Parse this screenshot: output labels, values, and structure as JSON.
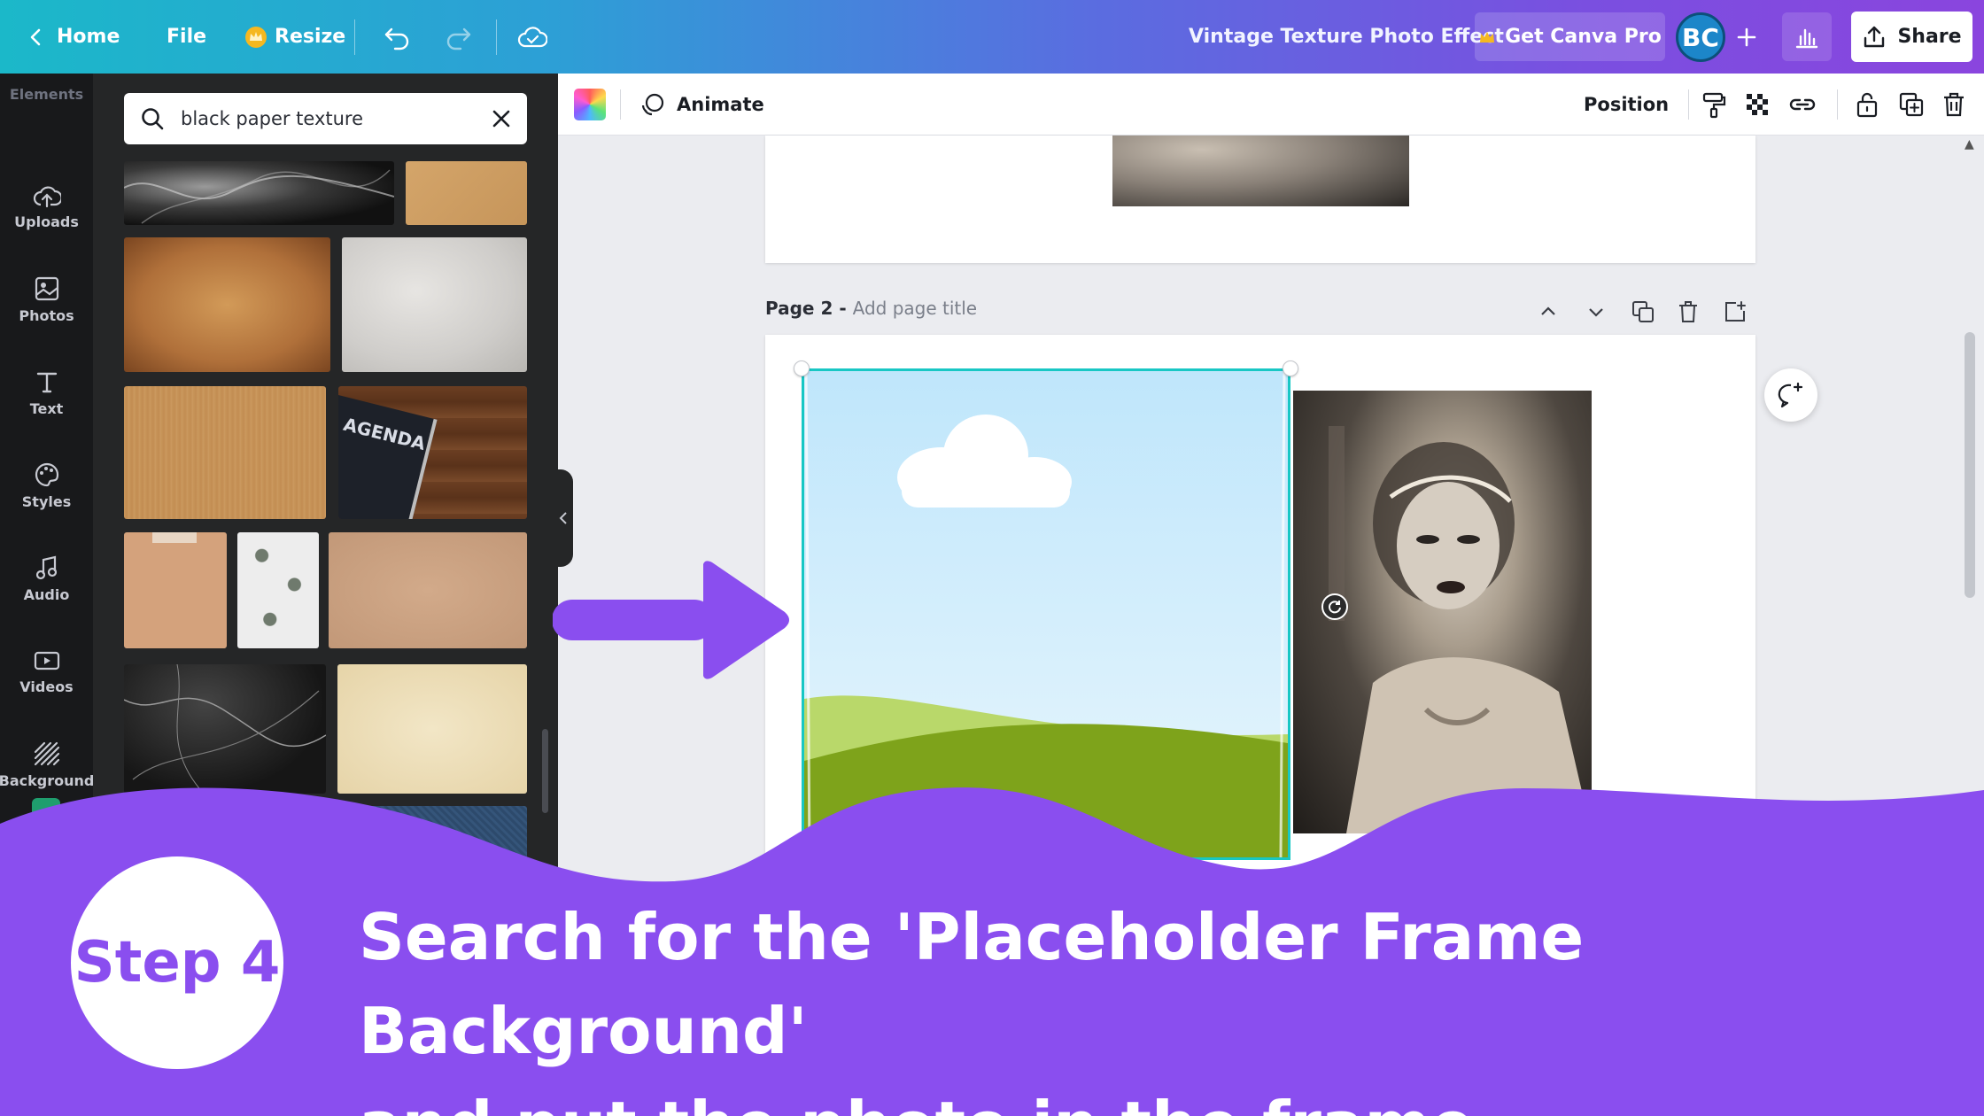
{
  "topbar": {
    "home_label": "Home",
    "file_label": "File",
    "resize_label": "Resize",
    "doc_title": "Vintage Texture Photo Effect",
    "pro_label": "Get Canva Pro",
    "avatar_initials": "BC",
    "share_label": "Share"
  },
  "rail": {
    "top_label": "Elements",
    "items": [
      {
        "label": "Uploads",
        "icon": "cloud-upload-icon"
      },
      {
        "label": "Photos",
        "icon": "image-icon"
      },
      {
        "label": "Text",
        "icon": "text-icon"
      },
      {
        "label": "Styles",
        "icon": "palette-icon"
      },
      {
        "label": "Audio",
        "icon": "music-note-icon"
      },
      {
        "label": "Videos",
        "icon": "video-icon"
      },
      {
        "label": "Background",
        "icon": "hatch-pattern-icon"
      }
    ]
  },
  "panel": {
    "search_value": "black paper texture",
    "thumb_labels": {
      "agenda": "AGENDA"
    }
  },
  "editor_toolbar": {
    "animate_label": "Animate",
    "position_label": "Position"
  },
  "canvas": {
    "page2_label": "Page 2 -",
    "page2_title_placeholder": "Add page title"
  },
  "overlay": {
    "step_label": "Step 4",
    "caption_line1": "Search for the 'Placeholder Frame Background'",
    "caption_line2": "and put the photo in the frame."
  },
  "colors": {
    "overlay_purple": "#8a4eef",
    "arrow_purple": "#8a4eef",
    "selection_teal": "#18c7c4",
    "brand_gradient_start": "#1bb8c9",
    "brand_gradient_end": "#8a45de"
  }
}
